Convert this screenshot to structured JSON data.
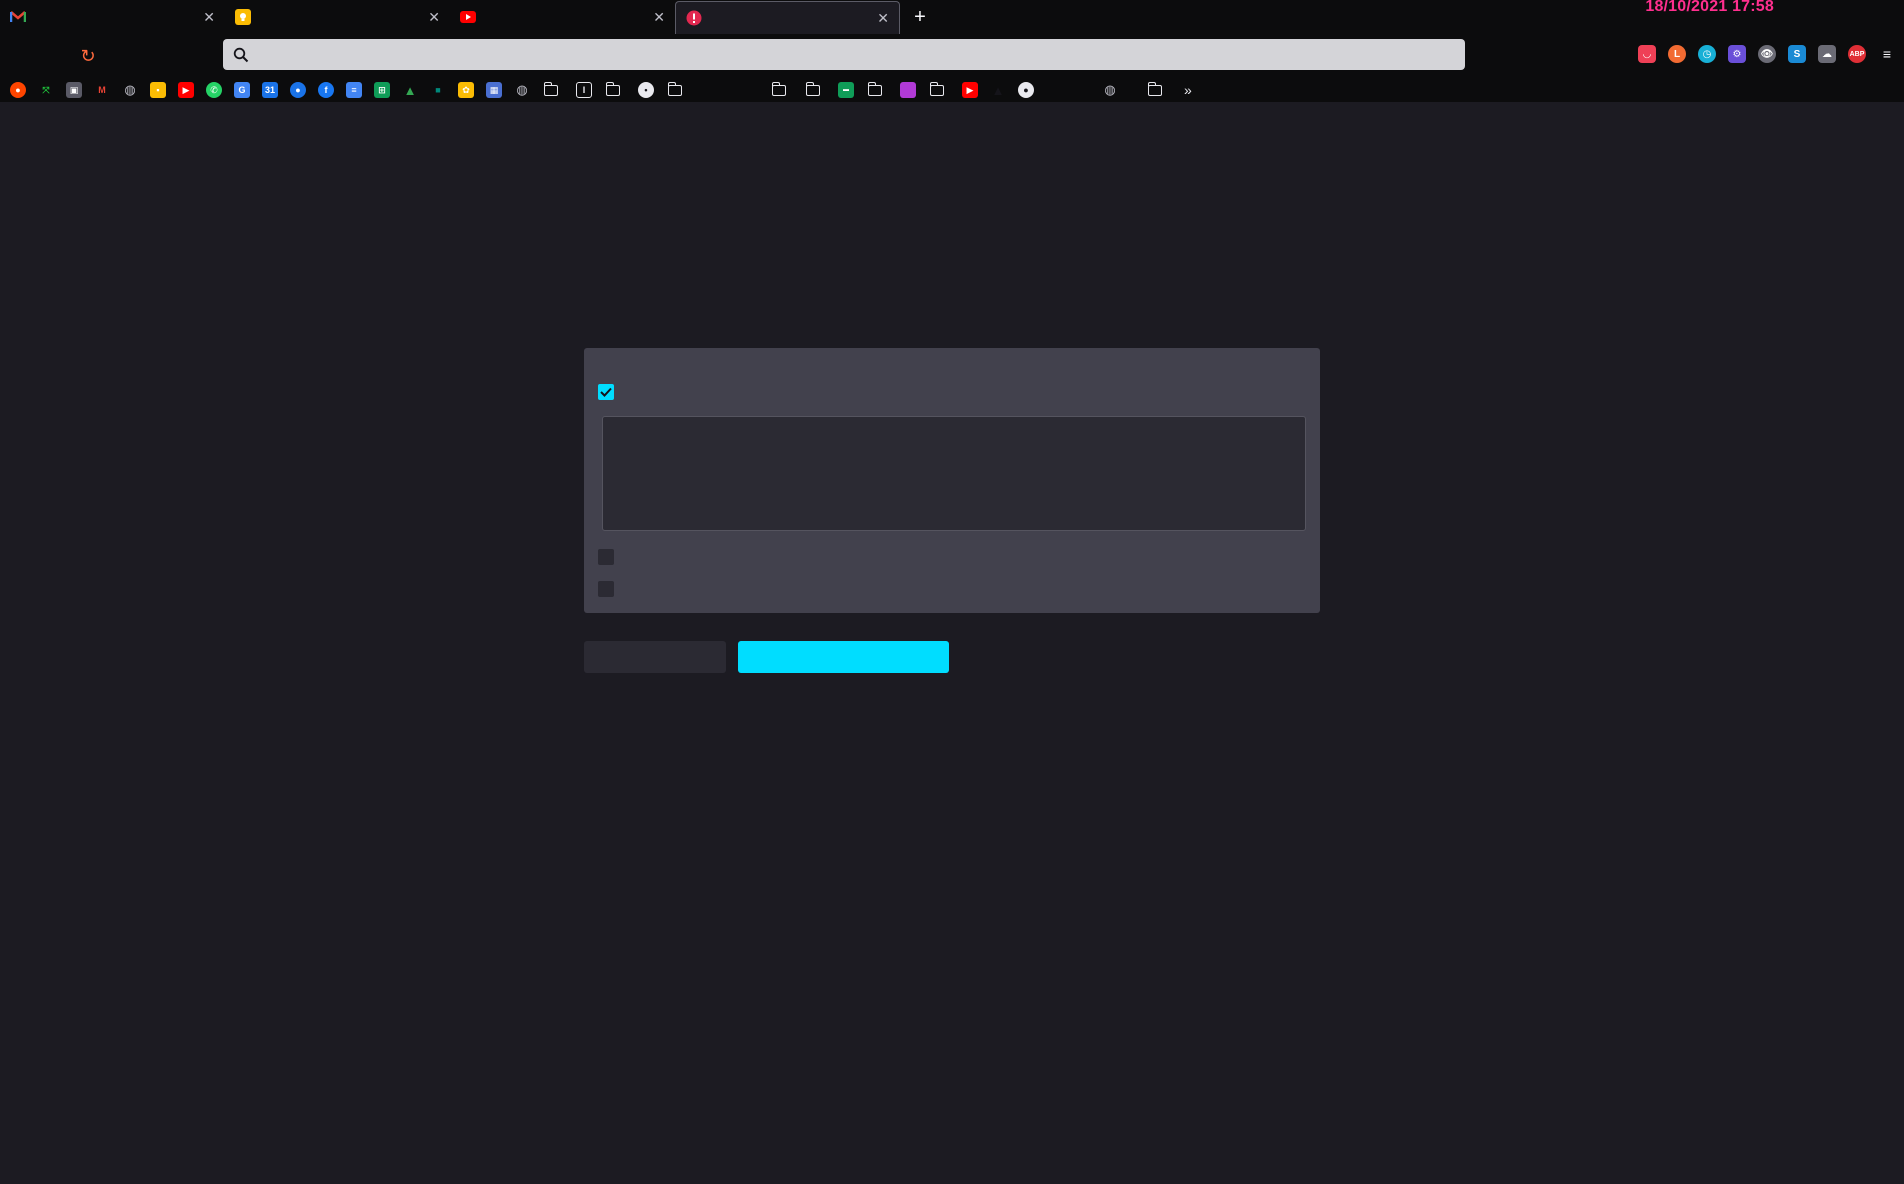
{
  "browser": {
    "tabs": [
      {
        "title": "",
        "icon": "gmail-icon",
        "color": "#ea4335"
      },
      {
        "title": "",
        "icon": "keep-notes-icon",
        "color": "#fbbc04"
      },
      {
        "title": "",
        "icon": "youtube-icon",
        "color": "#ff0000"
      },
      {
        "title": "",
        "icon": "error-alert-icon",
        "color": "#e22850"
      }
    ],
    "clock": "18/10/2021  17:58",
    "url": "",
    "accent": "#00ddff"
  },
  "bookmarks": {
    "icons": [
      {
        "icon": "reddit-icon",
        "color": "#ff4500"
      },
      {
        "icon": "expand-icon",
        "color": "#1fbf3a"
      },
      {
        "icon": "lock-icon",
        "color": "#5a5a66"
      },
      {
        "icon": "gmail-icon",
        "color": "#ea4335"
      },
      {
        "icon": "globe-icon",
        "color": "#6b6b75"
      },
      {
        "icon": "keep-icon",
        "color": "#fbbc04"
      },
      {
        "icon": "youtube-icon",
        "color": "#ff0000"
      },
      {
        "icon": "whatsapp-icon",
        "color": "#25d366"
      },
      {
        "icon": "translate-icon",
        "color": "#4285f4"
      },
      {
        "icon": "calendar-icon",
        "color": "#1a73e8"
      },
      {
        "icon": "contacts-icon",
        "color": "#1a73e8"
      },
      {
        "icon": "facebook-icon",
        "color": "#1877f2"
      },
      {
        "icon": "docs-icon",
        "color": "#4285f4"
      },
      {
        "icon": "sheets-icon",
        "color": "#0f9d58"
      },
      {
        "icon": "drive-icon",
        "color": "#34a853"
      },
      {
        "icon": "meet-icon",
        "color": "#00897b"
      },
      {
        "icon": "photos-icon",
        "color": "#fbbc04"
      },
      {
        "icon": "grid-icon",
        "color": "#4a6fd1"
      },
      {
        "icon": "globe-icon",
        "color": "#6b6b75"
      }
    ],
    "folders": [
      "",
      "",
      "",
      "",
      "",
      "",
      "",
      "",
      "",
      ""
    ],
    "more": "»"
  },
  "page": {
    "heading": "",
    "subheading": "",
    "intro": "",
    "panel": {
      "title": "",
      "description": "",
      "section1_title": "",
      "option1_label": "",
      "option1_checked": true,
      "textarea_placeholder": "",
      "option2_label": "",
      "option2_checked": false,
      "section2_title": "",
      "option3_label": "",
      "option3_checked": false
    },
    "buttons": {
      "secondary": "",
      "primary": ""
    }
  }
}
